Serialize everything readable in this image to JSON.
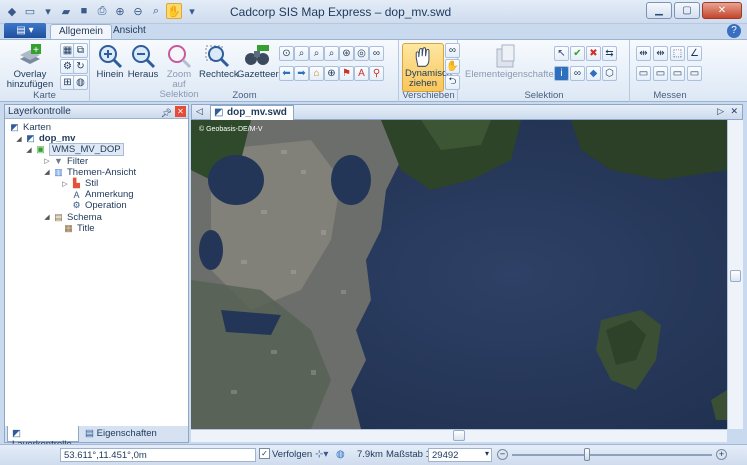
{
  "window": {
    "title": "Cadcorp SIS Map Express – dop_mv.swd"
  },
  "ribbon_tabs": [
    "Allgemein",
    "Ansicht"
  ],
  "groups": {
    "karte": {
      "label": "Karte",
      "overlay": "Overlay hinzufügen"
    },
    "zoom": {
      "label": "Zoom",
      "hinein": "Hinein",
      "heraus": "Heraus",
      "zoom_sel": "Zoom auf Selektion",
      "rechteck": "Rechteck",
      "gazetteer": "Gazetteer"
    },
    "verschieben": {
      "label": "Verschieben",
      "dynamisch": "Dynamisch ziehen"
    },
    "selektion": {
      "label": "Selektion",
      "eigenschaften": "Elementeigenschaften"
    },
    "messen": {
      "label": "Messen"
    }
  },
  "layer_panel": {
    "title": "Layerkontrolle",
    "nodes": [
      "Karten",
      "dop_mv",
      "WMS_MV_DOP",
      "Filter",
      "Themen-Ansicht",
      "Stil",
      "Anmerkung",
      "Operation",
      "Schema",
      "Title"
    ]
  },
  "panel_tabs": [
    "Layerkontrolle",
    "Eigenschaften"
  ],
  "document_tab": "dop_mv.swd",
  "map": {
    "copyright": "© Geobasis-DE/M-V"
  },
  "status": {
    "coords": "53.611°,11.451°,0m",
    "verfolgen": "Verfolgen",
    "distance": "7.9km",
    "massstab_label": "Maßstab 1:",
    "massstab_value": "29492"
  }
}
